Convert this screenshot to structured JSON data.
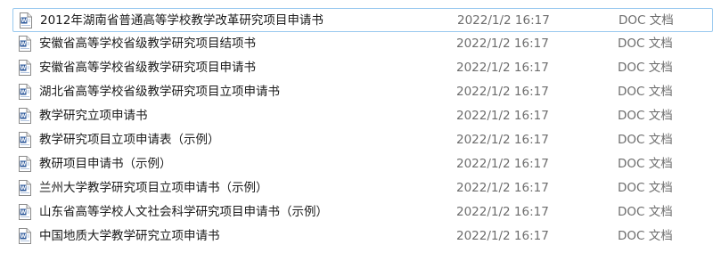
{
  "files": [
    {
      "name": "2012年湖南省普通高等学校教学改革研究项目申请书",
      "modified": "2022/1/2 16:17",
      "type": "DOC 文档",
      "icon": "word-doc-icon"
    },
    {
      "name": "安徽省高等学校省级教学研究项目结项书",
      "modified": "2022/1/2 16:17",
      "type": "DOC 文档",
      "icon": "word-doc-icon"
    },
    {
      "name": "安徽省高等学校省级教学研究项目申请书",
      "modified": "2022/1/2 16:17",
      "type": "DOC 文档",
      "icon": "word-doc-icon"
    },
    {
      "name": "湖北省高等学校省级教学研究项目立项申请书",
      "modified": "2022/1/2 16:17",
      "type": "DOC 文档",
      "icon": "word-doc-icon"
    },
    {
      "name": "教学研究立项申请书",
      "modified": "2022/1/2 16:17",
      "type": "DOC 文档",
      "icon": "word-doc-icon"
    },
    {
      "name": "教学研究项目立项申请表（示例）",
      "modified": "2022/1/2 16:17",
      "type": "DOC 文档",
      "icon": "word-doc-icon"
    },
    {
      "name": "教研项目申请书（示例）",
      "modified": "2022/1/2 16:17",
      "type": "DOC 文档",
      "icon": "word-doc-icon"
    },
    {
      "name": "兰州大学教学研究项目立项申请书（示例）",
      "modified": "2022/1/2 16:17",
      "type": "DOC 文档",
      "icon": "word-doc-icon"
    },
    {
      "name": "山东省高等学校人文社会科学研究项目申请书（示例）",
      "modified": "2022/1/2 16:17",
      "type": "DOC 文档",
      "icon": "word-doc-icon"
    },
    {
      "name": "中国地质大学教学研究立项申请书",
      "modified": "2022/1/2 16:17",
      "type": "DOC 文档",
      "icon": "word-doc-icon"
    }
  ],
  "colors": {
    "selection_border": "#99c9ef",
    "icon_blue": "#2b579a",
    "secondary_text": "#6d6d6d"
  }
}
